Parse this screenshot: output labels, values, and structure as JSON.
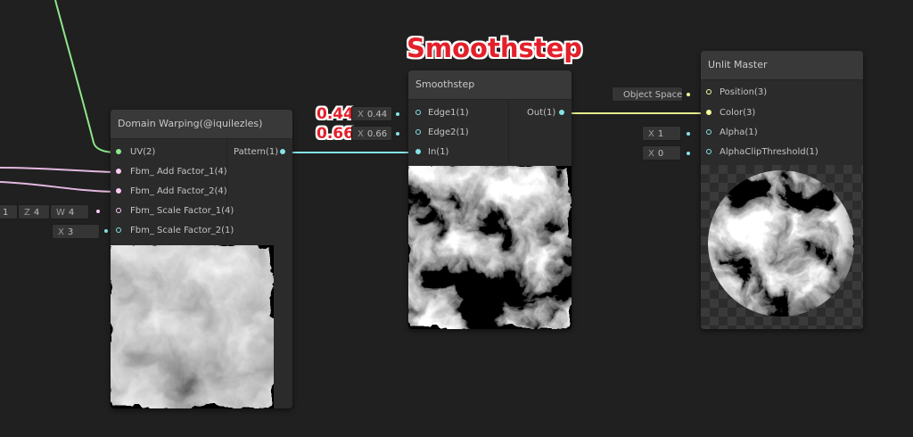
{
  "annotation": {
    "title": "Smoothstep",
    "edge1_value": "0.44",
    "edge2_value": "0.66"
  },
  "nodes": {
    "domain_warping": {
      "title": "Domain Warping(@iquilezles)",
      "inputs": [
        {
          "label": "UV(2)",
          "type": "uv"
        },
        {
          "label": "Fbm_ Add Factor_1(4)",
          "type": "vector4"
        },
        {
          "label": "Fbm_ Add Factor_2(4)",
          "type": "vector4"
        },
        {
          "label": "Fbm_ Scale Factor_1(4)",
          "type": "vector4"
        },
        {
          "label": "Fbm_ Scale Factor_2(1)",
          "type": "float"
        }
      ],
      "output": {
        "label": "Pattern(1)",
        "type": "float"
      },
      "scale_factor_1_fields": [
        {
          "axis": "",
          "value": "1"
        },
        {
          "axis": "Z",
          "value": "4"
        },
        {
          "axis": "W",
          "value": "4"
        }
      ],
      "scale_factor_2_field": {
        "axis": "X",
        "value": "3"
      }
    },
    "smoothstep": {
      "title": "Smoothstep",
      "inputs": [
        {
          "label": "Edge1(1)",
          "field_axis": "X",
          "field_value": "0.44"
        },
        {
          "label": "Edge2(1)",
          "field_axis": "X",
          "field_value": "0.66"
        },
        {
          "label": "In(1)"
        }
      ],
      "output": {
        "label": "Out(1)"
      }
    },
    "unlit_master": {
      "title": "Unlit Master",
      "inputs": [
        {
          "label": "Position(3)",
          "field_value": "Object Space",
          "type": "vector3"
        },
        {
          "label": "Color(3)",
          "type": "vector3"
        },
        {
          "label": "Alpha(1)",
          "field_axis": "X",
          "field_value": "1",
          "type": "float"
        },
        {
          "label": "AlphaClipThreshold(1)",
          "field_axis": "X",
          "field_value": "0",
          "type": "float"
        }
      ]
    }
  },
  "colors": {
    "background": "#202020",
    "float_port": "#84e4e7",
    "vector3_port": "#f6ff9a",
    "vector4_port": "#fbcbf4",
    "uv_port": "#8ee68a",
    "annotation_red": "#e3202a"
  }
}
